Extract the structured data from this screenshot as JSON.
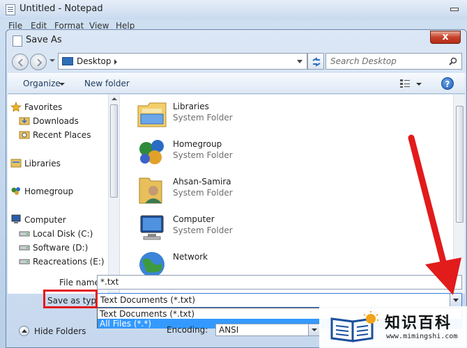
{
  "notepad": {
    "title": "Untitled - Notepad",
    "menu": [
      "File",
      "Edit",
      "Format",
      "View",
      "Help"
    ]
  },
  "dialog": {
    "title": "Save As",
    "close_label": "x",
    "address": "Desktop",
    "search_placeholder": "Search Desktop",
    "toolbar": {
      "organize": "Organize",
      "new_folder": "New folder",
      "help": "?"
    },
    "nav": [
      {
        "label": "Favorites",
        "icon": "star-icon"
      },
      {
        "label": "Downloads",
        "icon": "download-folder-icon"
      },
      {
        "label": "Recent Places",
        "icon": "recent-places-icon"
      },
      {
        "label": "Libraries",
        "icon": "libraries-icon"
      },
      {
        "label": "Homegroup",
        "icon": "homegroup-icon"
      },
      {
        "label": "Computer",
        "icon": "computer-icon"
      },
      {
        "label": "Local Disk (C:)",
        "icon": "drive-icon"
      },
      {
        "label": "Software (D:)",
        "icon": "drive-icon"
      },
      {
        "label": "Reacreations (E:)",
        "icon": "drive-icon"
      }
    ],
    "files": [
      {
        "name": "Libraries",
        "type": "System Folder",
        "icon": "libraries-folder-icon"
      },
      {
        "name": "Homegroup",
        "type": "System Folder",
        "icon": "homegroup-icon"
      },
      {
        "name": "Ahsan-Samira",
        "type": "System Folder",
        "icon": "user-folder-icon"
      },
      {
        "name": "Computer",
        "type": "System Folder",
        "icon": "computer-icon"
      },
      {
        "name": "Network",
        "type": "",
        "icon": "network-icon"
      }
    ],
    "form": {
      "file_name_label": "File name:",
      "file_name_value": "*.txt",
      "save_type_label": "Save as type:",
      "save_type_value": "Text Documents (*.txt)",
      "save_type_options": [
        "Text Documents (*.txt)",
        "All Files  (*.*)"
      ],
      "hide_folders": "Hide Folders",
      "encoding_label": "Encoding:",
      "encoding_value": "ANSI"
    }
  },
  "watermark": {
    "title": "知识百科",
    "url": "www.mimingshi.com"
  },
  "colors": {
    "annotation_red": "#e21b1b",
    "selection_blue": "#3399ff"
  }
}
